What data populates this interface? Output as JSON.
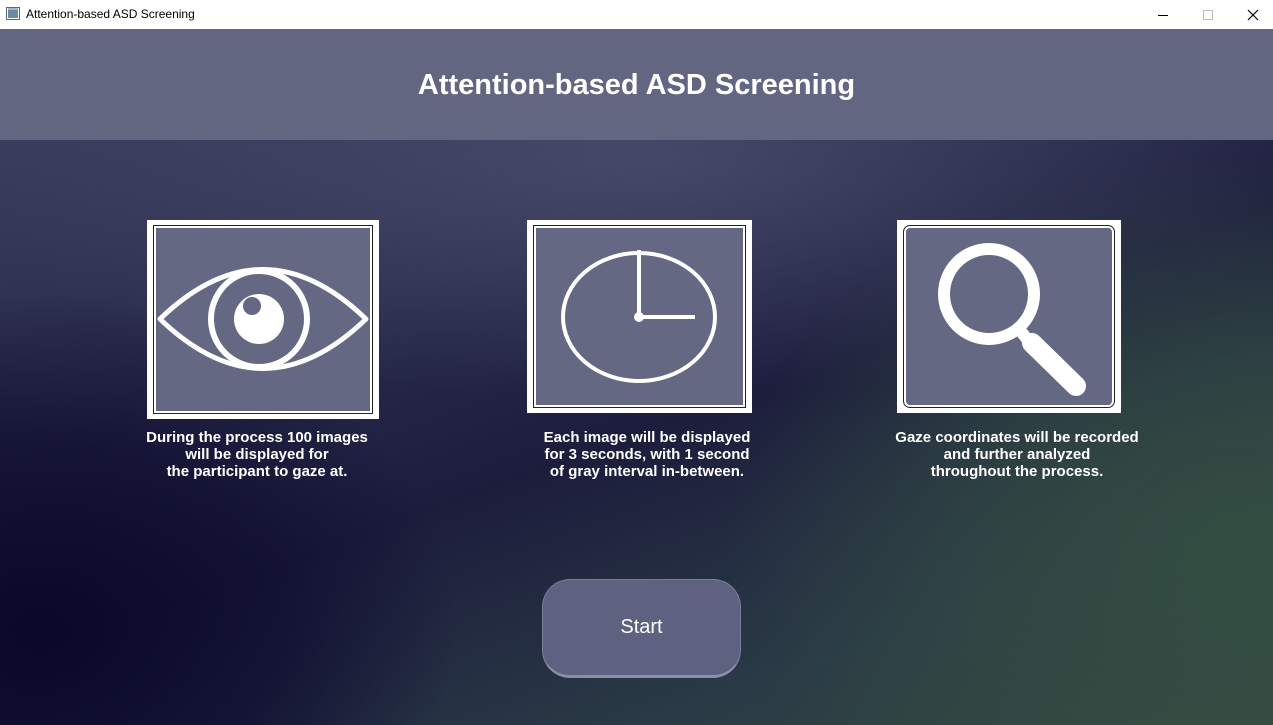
{
  "window": {
    "title": "Attention-based ASD Screening",
    "icon": "app-window-icon",
    "controls": [
      "minimize-icon",
      "maximize-icon",
      "close-icon"
    ]
  },
  "header": {
    "title": "Attention-based ASD Screening",
    "background": "#626680"
  },
  "cards": [
    {
      "icon": "eye-icon",
      "caption": "During the process 100 images\nwill be displayed for\nthe participant to gaze at."
    },
    {
      "icon": "clock-icon",
      "caption": "Each image will be displayed\nfor 3 seconds, with 1 second\nof gray interval in-between."
    },
    {
      "icon": "magnifier-icon",
      "caption": "Gaze coordinates will be recorded\nand further analyzed\nthroughout the process."
    }
  ],
  "start_button": {
    "label": "Start"
  },
  "colors": {
    "panel": "#646882",
    "accent": "#ffffff",
    "button": "#5e6280"
  }
}
